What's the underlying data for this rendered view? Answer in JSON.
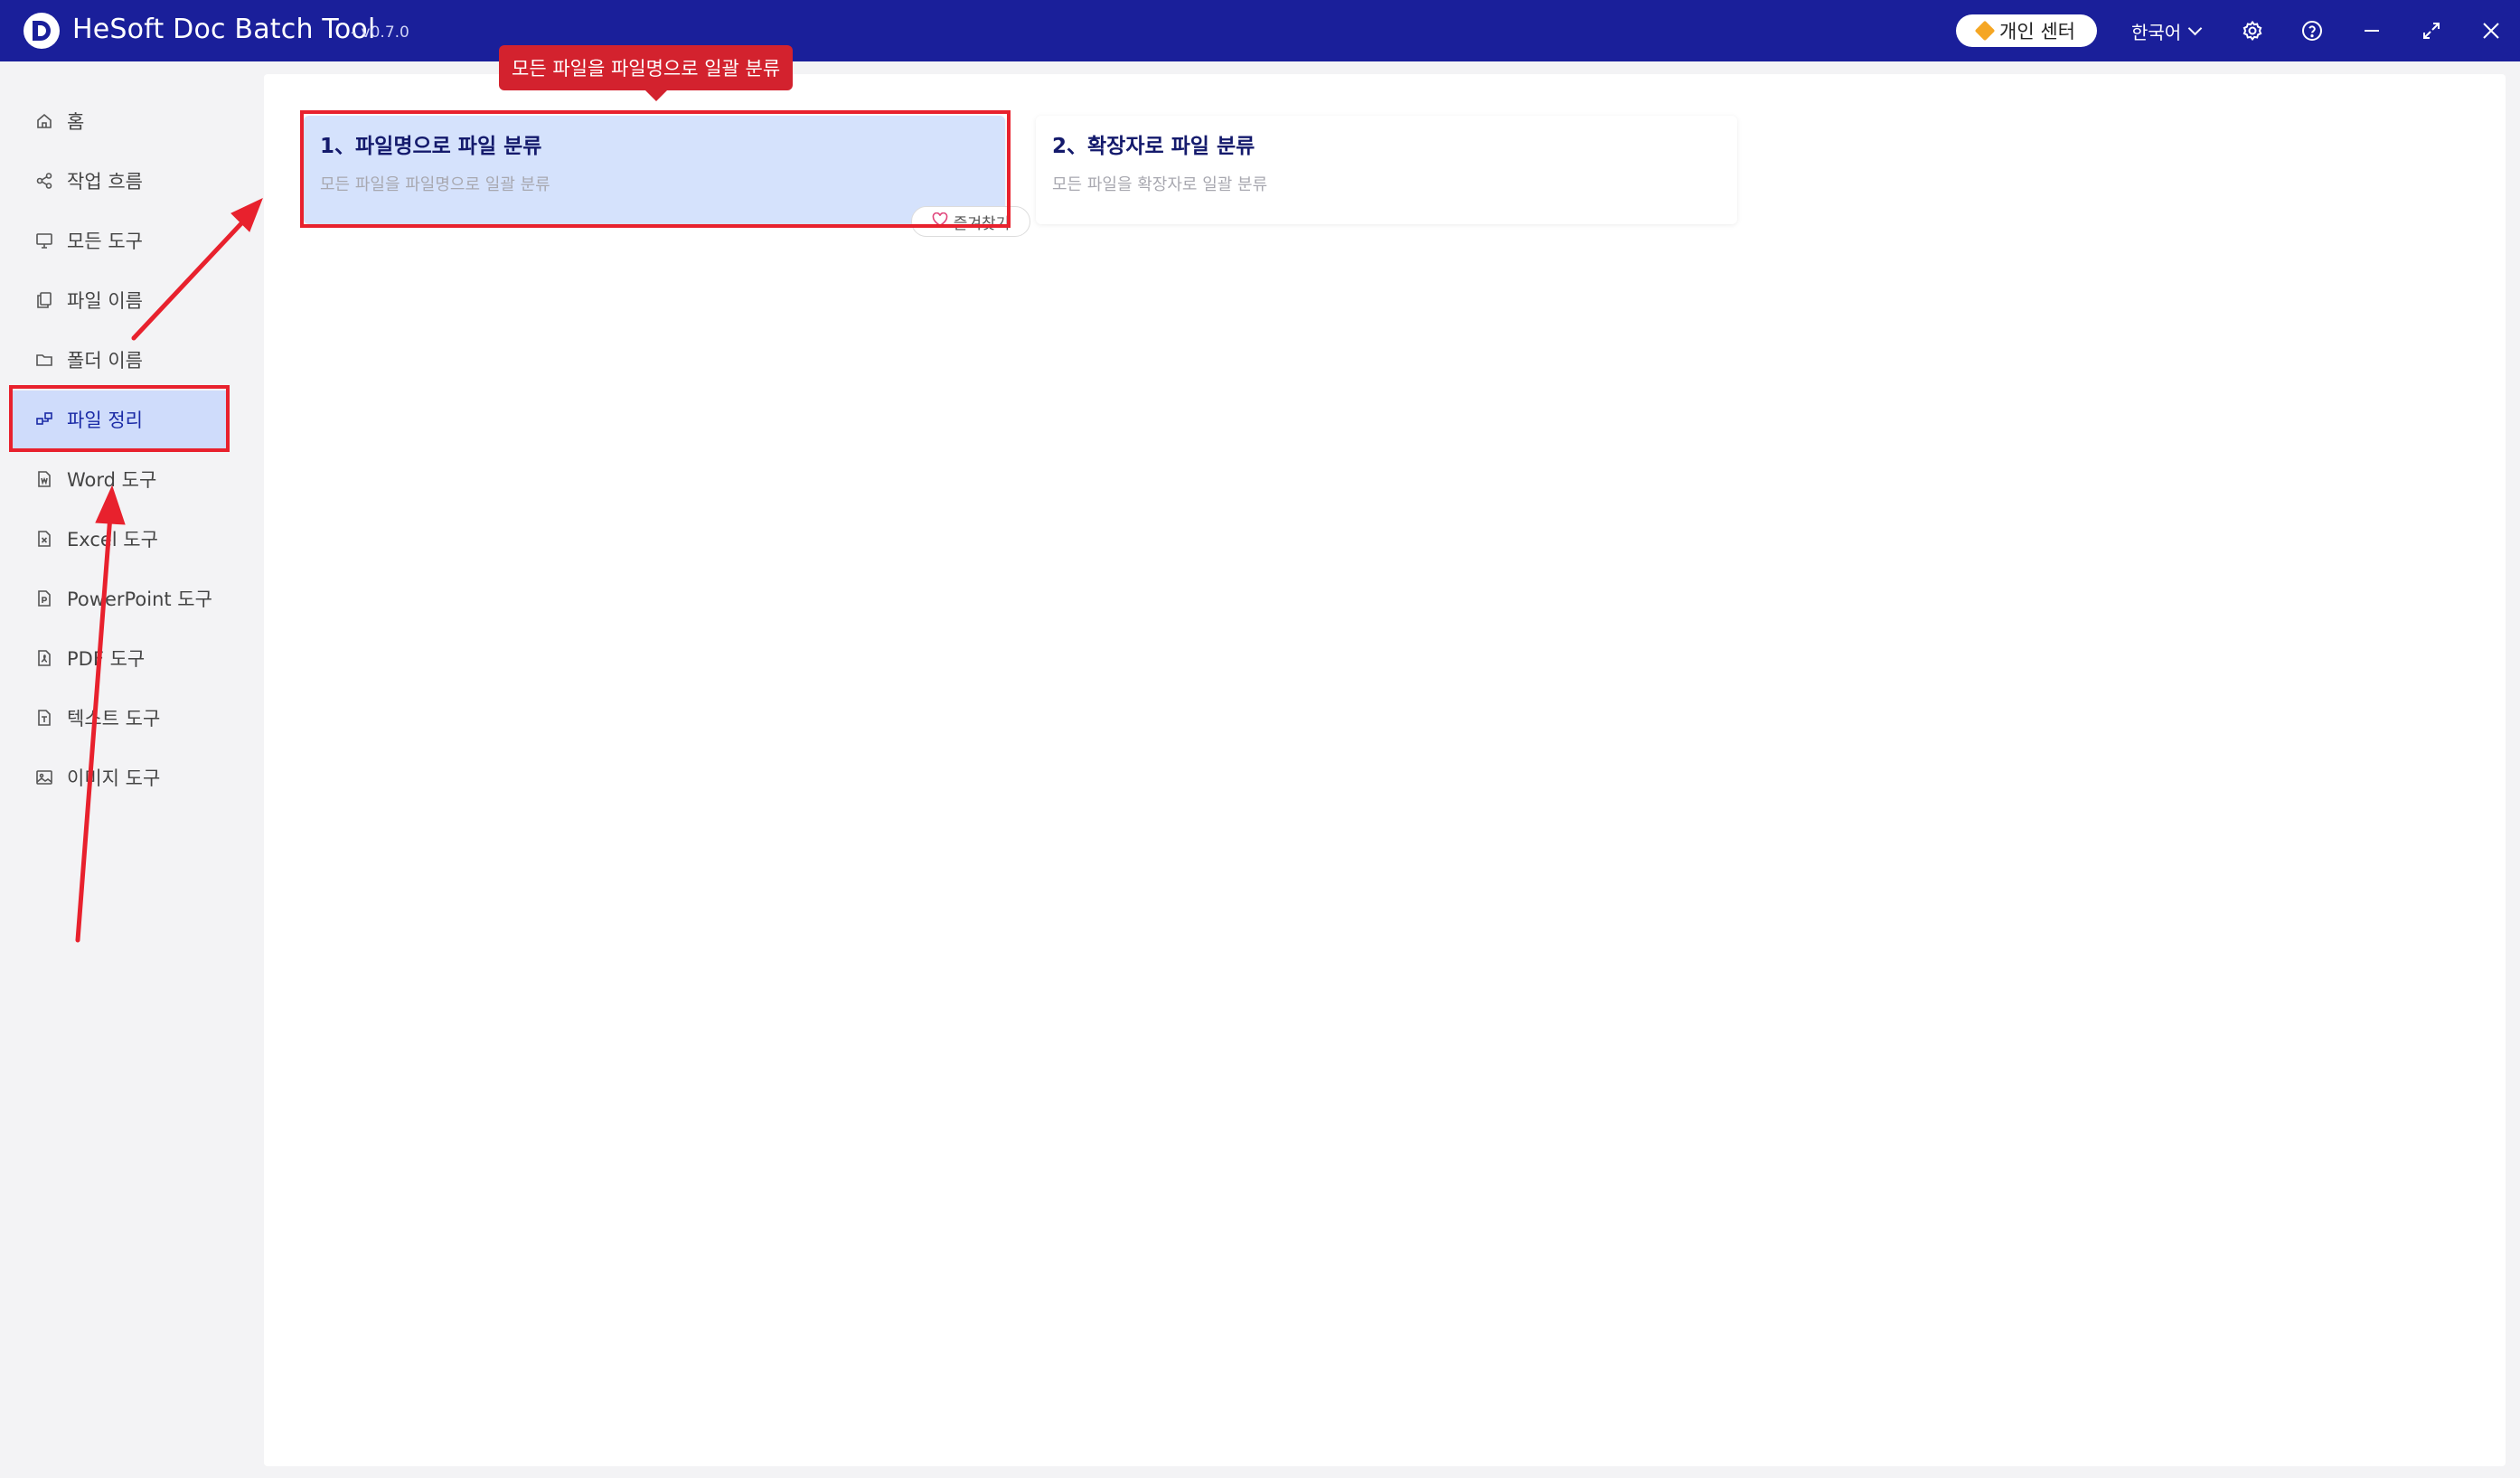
{
  "window": {
    "title": "HeSoft Doc Batch Tool",
    "version": "- v0.7.0",
    "personal_center": "개인 센터",
    "language": "한국어"
  },
  "sidebar": {
    "items": [
      {
        "label": "홈",
        "icon": "home-icon"
      },
      {
        "label": "작업 흐름",
        "icon": "workflow-icon"
      },
      {
        "label": "모든 도구",
        "icon": "monitor-icon"
      },
      {
        "label": "파일 이름",
        "icon": "file-copy-icon"
      },
      {
        "label": "폴더 이름",
        "icon": "folder-icon"
      },
      {
        "label": "파일 정리",
        "icon": "organize-icon",
        "active": true
      },
      {
        "label": "Word 도구",
        "icon": "word-file-icon"
      },
      {
        "label": "Excel 도구",
        "icon": "excel-file-icon"
      },
      {
        "label": "PowerPoint 도구",
        "icon": "ppt-file-icon"
      },
      {
        "label": "PDF 도구",
        "icon": "pdf-file-icon"
      },
      {
        "label": "텍스트 도구",
        "icon": "text-file-icon"
      },
      {
        "label": "이미지 도구",
        "icon": "image-icon"
      }
    ]
  },
  "main": {
    "cards": [
      {
        "title": "1、파일명으로 파일 분류",
        "desc": "모든 파일을 파일명으로 일괄 분류"
      },
      {
        "title": "2、확장자로 파일 분류",
        "desc": "모든 파일을 확장자로 일괄 분류"
      }
    ],
    "favorite_label": "즐겨찾기",
    "tooltip": "모든 파일을 파일명으로 일괄 분류"
  },
  "colors": {
    "titlebar": "#1a1f9a",
    "active_nav": "#cfdcfb",
    "annotation": "#e8212d",
    "tooltip": "#d3222e"
  }
}
